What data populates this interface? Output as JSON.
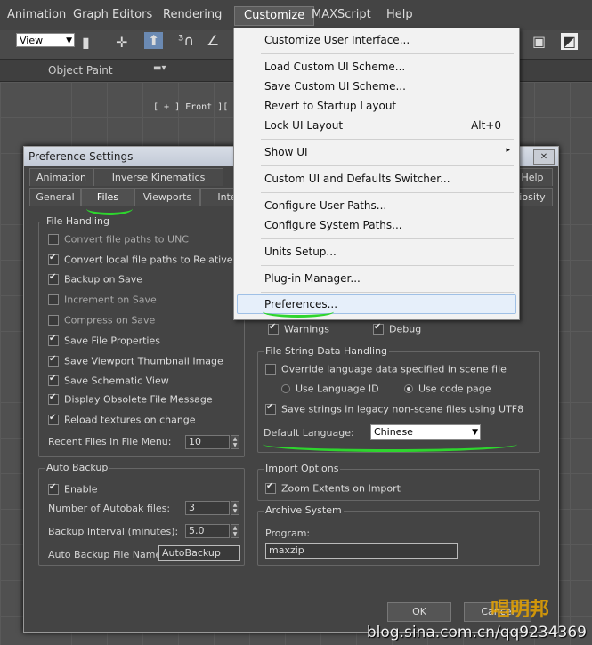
{
  "menubar": {
    "items": [
      "Animation",
      "Graph Editors",
      "Rendering",
      "Customize",
      "MAXScript",
      "Help"
    ]
  },
  "toolbar": {
    "view_combo": "View"
  },
  "ribbon": {
    "label": "Object Paint"
  },
  "viewport": {
    "label": "[ + ] Front ][ Wi"
  },
  "dialog": {
    "title": "Preference Settings",
    "close_glyph": "✕",
    "tabs_row1": [
      "Animation",
      "Inverse Kinematics",
      "Help"
    ],
    "tabs_row2": [
      "General",
      "Files",
      "Viewports",
      "Inte",
      "iosity"
    ],
    "file_handling": {
      "title": "File Handling",
      "options": [
        {
          "label": "Convert file paths to UNC",
          "checked": false,
          "enabled": false
        },
        {
          "label": "Convert local file paths to Relative",
          "checked": true,
          "enabled": true
        },
        {
          "label": "Backup on Save",
          "checked": true,
          "enabled": true
        },
        {
          "label": "Increment on Save",
          "checked": false,
          "enabled": false
        },
        {
          "label": "Compress on Save",
          "checked": false,
          "enabled": false
        },
        {
          "label": "Save File Properties",
          "checked": true,
          "enabled": true
        },
        {
          "label": "Save Viewport Thumbnail Image",
          "checked": true,
          "enabled": true
        },
        {
          "label": "Save Schematic View",
          "checked": true,
          "enabled": true
        },
        {
          "label": "Display Obsolete File Message",
          "checked": true,
          "enabled": true
        },
        {
          "label": "Reload textures on change",
          "checked": true,
          "enabled": true
        }
      ],
      "recent_label": "Recent Files in File Menu:",
      "recent_value": "10"
    },
    "auto_backup": {
      "title": "Auto Backup",
      "enable_label": "Enable",
      "num_label": "Number of Autobak files:",
      "num_value": "3",
      "interval_label": "Backup Interval (minutes):",
      "interval_value": "5.0",
      "name_label": "Auto Backup File Name:",
      "name_value": "AutoBackup"
    },
    "log": {
      "warnings": "Warnings",
      "debug": "Debug"
    },
    "file_string": {
      "title": "File String Data Handling",
      "override_label": "Override language data specified in scene file",
      "radio_lang_id": "Use Language ID",
      "radio_code_page": "Use code page",
      "utf8_label": "Save strings in legacy non-scene files using UTF8",
      "default_lang_label": "Default Language:",
      "default_lang_value": "Chinese"
    },
    "import_options": {
      "title": "Import Options",
      "zoom_label": "Zoom Extents on Import"
    },
    "archive": {
      "title": "Archive System",
      "program_label": "Program:",
      "program_value": "maxzip"
    },
    "ok_label": "OK",
    "cancel_label": "Cancel"
  },
  "customize_menu": {
    "items": [
      {
        "label": "Customize User Interface...",
        "shortcut": ""
      },
      {
        "label": "Load Custom UI Scheme...",
        "shortcut": ""
      },
      {
        "label": "Save Custom UI Scheme...",
        "shortcut": ""
      },
      {
        "label": "Revert to Startup Layout",
        "shortcut": ""
      },
      {
        "label": "Lock UI Layout",
        "shortcut": "Alt+0"
      },
      {
        "label": "Show UI",
        "shortcut": "▸"
      },
      {
        "label": "Custom UI and Defaults Switcher...",
        "shortcut": ""
      },
      {
        "label": "Configure User Paths...",
        "shortcut": ""
      },
      {
        "label": "Configure System Paths...",
        "shortcut": ""
      },
      {
        "label": "Units Setup...",
        "shortcut": ""
      },
      {
        "label": "Plug-in Manager...",
        "shortcut": ""
      },
      {
        "label": "Preferences...",
        "shortcut": ""
      }
    ]
  },
  "watermark": {
    "text": "blog.sina.com.cn/qq9234369",
    "cn_text": "唱明邦"
  },
  "colors": {
    "highlight_underline": "#2ed52e",
    "menu_bg": "#f2f2f2",
    "dialog_bg": "#444444"
  }
}
